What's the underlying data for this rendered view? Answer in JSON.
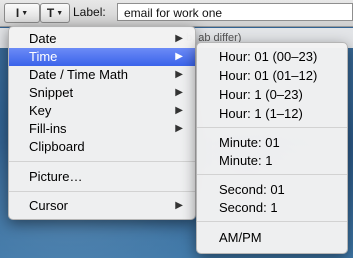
{
  "toolbar": {
    "cursor_button_glyph": "I",
    "text_button_glyph": "T",
    "label_caption": "Label:",
    "label_value": "email for work one"
  },
  "background_partial_text": "b, ab differ)",
  "menu": {
    "items": [
      {
        "label": "Date",
        "has_submenu": true
      },
      {
        "label": "Time",
        "has_submenu": true,
        "selected": true
      },
      {
        "label": "Date / Time Math",
        "has_submenu": true
      },
      {
        "label": "Snippet",
        "has_submenu": true
      },
      {
        "label": "Key",
        "has_submenu": true
      },
      {
        "label": "Fill-ins",
        "has_submenu": true
      },
      {
        "label": "Clipboard",
        "has_submenu": false
      },
      {
        "label": "Picture…",
        "has_submenu": false
      },
      {
        "label": "Cursor",
        "has_submenu": true
      }
    ],
    "submenu_arrow": "▶"
  },
  "submenu": {
    "items": [
      {
        "label": "Hour: 01 (00–23)"
      },
      {
        "label": "Hour: 01 (01–12)"
      },
      {
        "label": "Hour: 1 (0–23)"
      },
      {
        "label": "Hour: 1 (1–12)"
      },
      {
        "label": "Minute: 01"
      },
      {
        "label": "Minute: 1"
      },
      {
        "label": "Second: 01"
      },
      {
        "label": "Second: 1"
      },
      {
        "label": "AM/PM"
      }
    ]
  },
  "colors": {
    "selection": "#3f66ea",
    "menu_bg": "#f2f2f2"
  }
}
